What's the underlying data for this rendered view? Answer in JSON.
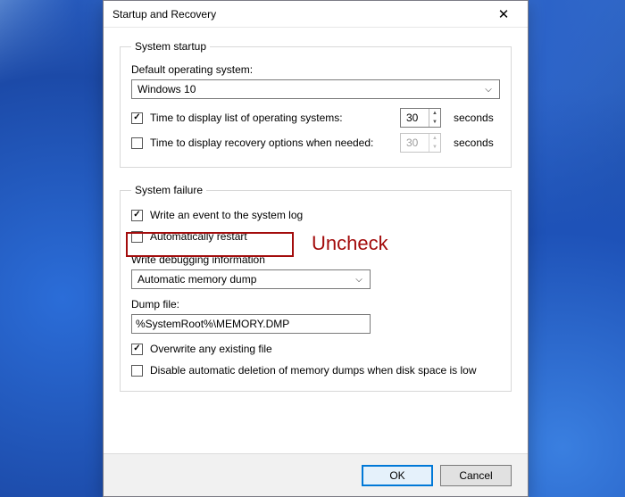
{
  "dialog": {
    "title": "Startup and Recovery"
  },
  "startup": {
    "legend": "System startup",
    "default_os_label": "Default operating system:",
    "default_os_value": "Windows 10",
    "time_os_list_label": "Time to display list of operating systems:",
    "time_os_list_value": "30",
    "time_os_list_checked": true,
    "time_recovery_label": "Time to display recovery options when needed:",
    "time_recovery_value": "30",
    "time_recovery_checked": false,
    "seconds_label": "seconds"
  },
  "failure": {
    "legend": "System failure",
    "write_event_label": "Write an event to the system log",
    "write_event_checked": true,
    "auto_restart_label": "Automatically restart",
    "auto_restart_checked": false,
    "debug_info_label": "Write debugging information",
    "debug_info_value": "Automatic memory dump",
    "dump_file_label": "Dump file:",
    "dump_file_value": "%SystemRoot%\\MEMORY.DMP",
    "overwrite_label": "Overwrite any existing file",
    "overwrite_checked": true,
    "disable_delete_label": "Disable automatic deletion of memory dumps when disk space is low",
    "disable_delete_checked": false
  },
  "annotation": {
    "text": "Uncheck"
  },
  "buttons": {
    "ok": "OK",
    "cancel": "Cancel"
  }
}
